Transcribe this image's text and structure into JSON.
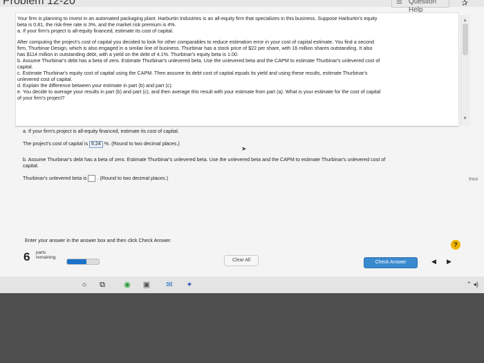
{
  "header": {
    "title": "Problem 12-20",
    "help_label": "Question Help",
    "star_icon": "star-icon"
  },
  "question": {
    "para1_line1": "Your firm is planning to invest in an automated packaging plant. Harburtin Industries is an all-equity firm that specializes in this business. Suppose Harburtin's equity",
    "para1_line2": "beta is 0.81, the risk-free rate is 3%, and the market risk premium is 4%.",
    "para1_line3": "a. If your firm's project is all-equity financed, estimate its cost of capital.",
    "para2_line1": "After computing the project's cost of capital you decided to look for other comparables to reduce estimation error in your cost of capital estimate. You find a second",
    "para2_line2": "firm, Thurbinar Design, which is also engaged in a similar line of business. Thurbinar has a stock price of $22 per share, with 16 million shares outstanding. It also",
    "para2_line3": "has $114 million in outstanding debt, with a yield on the debt of 4.1%. Thurbinar's equity beta is 1.00.",
    "para2_b1": "b. Assume Thurbinar's debt has a beta of zero. Estimate Thurbinar's unlevered beta. Use the unlevered beta and the CAPM to estimate Thurbinar's unlevered cost of",
    "para2_b2": "capital.",
    "para2_c1": "c. Estimate Thurbinar's equity cost of capital using the CAPM. Then assume its debt cost of capital equals its yield and using these results, estimate Thurbinar's",
    "para2_c2": "unlevered cost of capital.",
    "para2_d": "d. Explain the difference between your estimate in part (b) and part (c).",
    "para2_e1": "e. You decide to average your results in part (b) and part (c), and then average this result with your estimate from part (a). What is your estimate for the cost of capital",
    "para2_e2": "of your firm's project?"
  },
  "answers": {
    "part_a_prompt": "a. If your firm's project is all-equity financed, estimate its cost of capital.",
    "part_a_pre": "The project's cost of capital is",
    "part_a_value": "6.24",
    "part_a_post": "%.  (Round to two decimal places.)",
    "part_b_prompt1": "b. Assume Thurbinar's debt has a beta of zero. Estimate Thurbinar's unlevered beta. Use the unlevered beta and the CAPM to estimate Thurbinar's unlevered cost of",
    "part_b_prompt2": "capital.",
    "part_b_pre": "Thurbinar's unlevered beta is",
    "part_b_post": ".  (Round to two decimal places.)",
    "incorrect_label": "Inco"
  },
  "footer": {
    "instruction": "Enter your answer in the answer box and then click Check Answer.",
    "parts_count": "6",
    "parts_label1": "parts",
    "parts_label2": "remaining",
    "progress_fraction": 0.6,
    "clear_label": "Clear All",
    "check_label": "Check Answer",
    "help_icon": "?"
  },
  "taskbar": {
    "icons": [
      "search-icon",
      "task-view-icon",
      "chrome-icon",
      "store-icon",
      "mail-icon",
      "teams-icon"
    ]
  },
  "colors": {
    "accent": "#3a8ad0",
    "progress": "#1a73c8"
  }
}
